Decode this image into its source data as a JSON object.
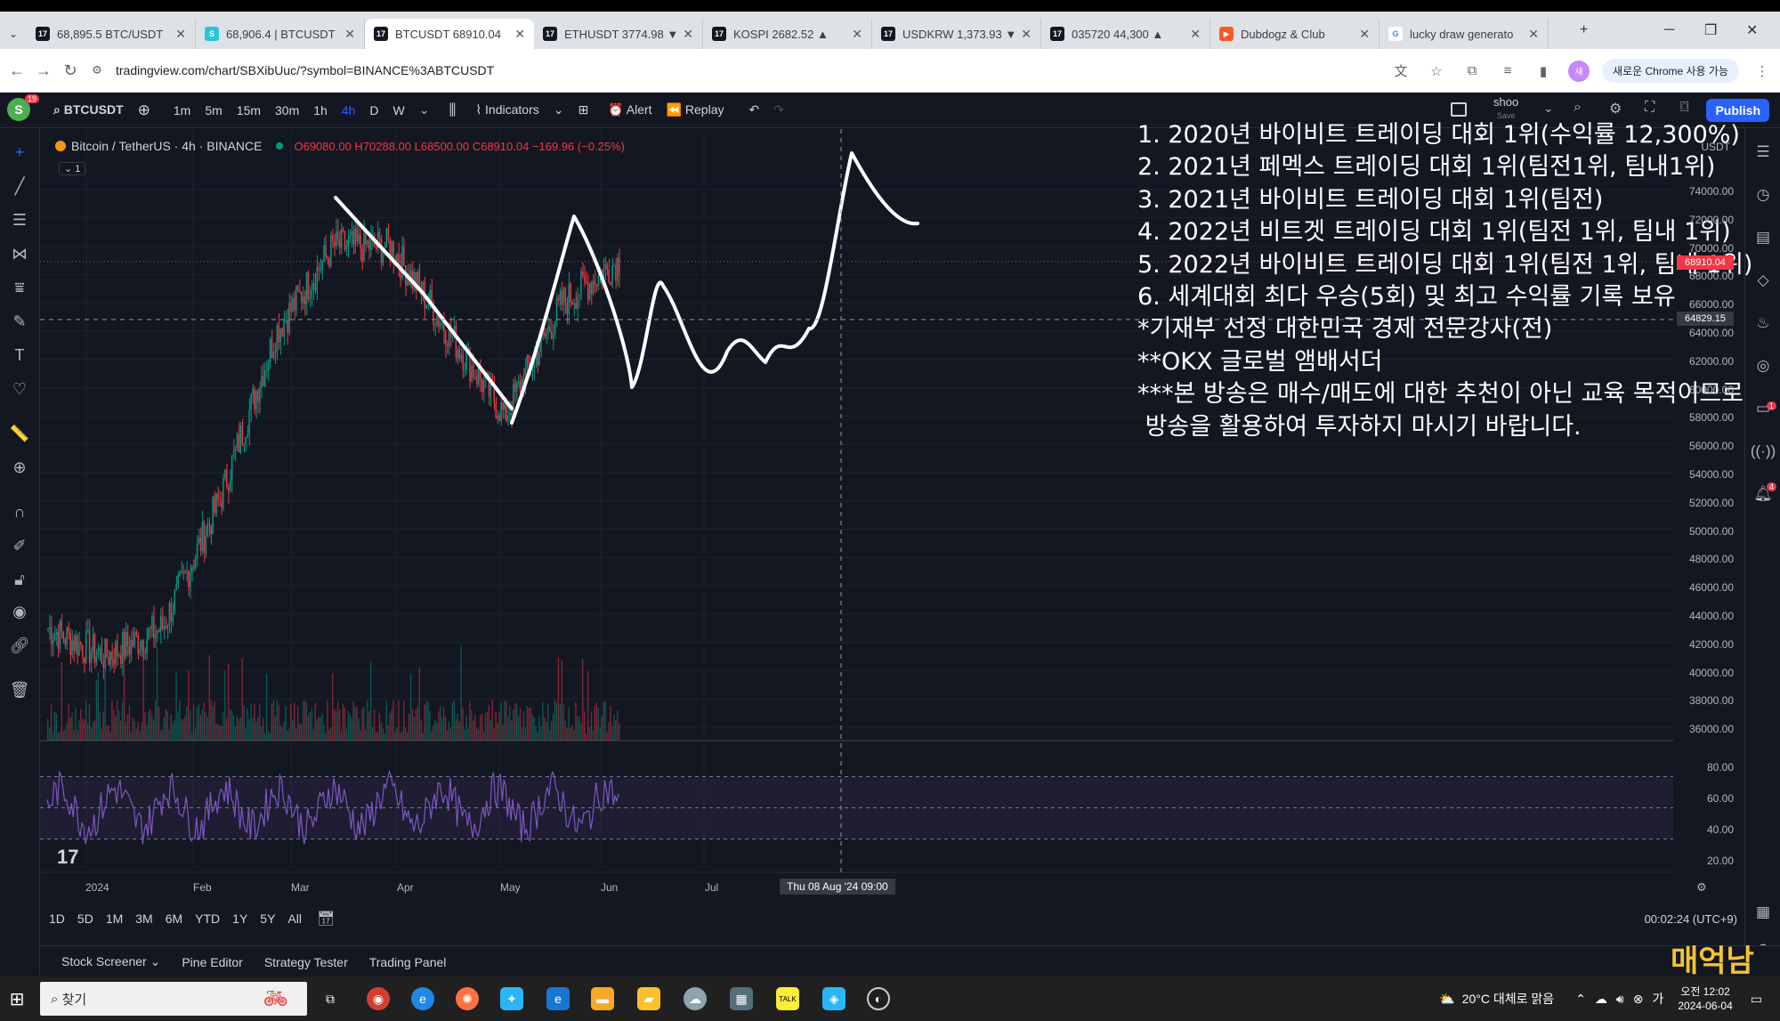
{
  "browser": {
    "tabs": [
      {
        "label": "68,895.5 BTC/USDT",
        "icon": "tradingview"
      },
      {
        "label": "68,906.4 | BTCUSDT",
        "icon": "cyan-s"
      },
      {
        "label": "BTCUSDT 68910.04",
        "icon": "tradingview"
      },
      {
        "label": "ETHUSDT 3774.98 ▼",
        "icon": "tradingview"
      },
      {
        "label": "KOSPI 2682.52 ▲",
        "icon": "tradingview"
      },
      {
        "label": "USDKRW 1,373.93 ▼",
        "icon": "tradingview"
      },
      {
        "label": "035720 44,300 ▲",
        "icon": "tradingview"
      },
      {
        "label": "Dubdogz & Club",
        "icon": "youtube"
      },
      {
        "label": "lucky draw generato",
        "icon": "google"
      }
    ],
    "url": "tradingview.com/chart/SBXibUuc/?symbol=BINANCE%3ABTCUSDT",
    "chrome_button": "새로운 Chrome 사용 가능"
  },
  "toolbar": {
    "avatar": "S",
    "avatar_badge": "19",
    "symbol": "BTCUSDT",
    "intervals": [
      "1m",
      "5m",
      "15m",
      "30m",
      "1h",
      "4h",
      "D",
      "W"
    ],
    "selected_interval": "4h",
    "indicators": "Indicators",
    "alert": "Alert",
    "replay": "Replay",
    "layout_name": "shoo",
    "layout_sub": "Save",
    "publish": "Publish"
  },
  "legend": {
    "symbol": "Bitcoin / TetherUS · 4h · BINANCE",
    "ohlc": "O69080.00 H70288.00 L68500.00 C68910.04 −169.96 (−0.25%)",
    "collapse": "1"
  },
  "overlay": {
    "lines": [
      "1. 2020년 바이비트 트레이딩 대회 1위(수익률 12,300%)",
      "2. 2021년 페멕스 트레이딩 대회 1위(팀전1위, 팀내1위)",
      "3. 2021년 바이비트 트레이딩 대회 1위(팀전)",
      "4. 2022년 비트겟 트레이딩 대회 1위(팀전 1위, 팀내 1위)",
      "5. 2022년 바이비트 트레이딩 대회 1위(팀전 1위, 팀내 1위)",
      "6. 세계대회 최다 우승(5회) 및 최고 수익률 기록 보유",
      "*기재부 선정 대한민국 경제 전문강사(전)",
      "**OKX 글로벌 앰배서더",
      "***본 방송은 매수/매도에 대한 추천이 아닌 교육 목적이므로",
      " 방송을 활용하여 투자하지 마시기 바랍니다."
    ]
  },
  "price_axis": {
    "currency": "USDT",
    "ticks": [
      "74000.00",
      "72000.00",
      "70000.00",
      "68000.00",
      "66000.00",
      "64000.00",
      "62000.00",
      "60000.00",
      "58000.00",
      "56000.00",
      "54000.00",
      "52000.00",
      "50000.00",
      "48000.00",
      "46000.00",
      "44000.00",
      "42000.00",
      "40000.00",
      "38000.00",
      "36000.00"
    ],
    "current_price": "68910.04",
    "crosshair_price": "64829.15",
    "rsi_ticks": [
      "80.00",
      "60.00",
      "40.00",
      "20.00"
    ]
  },
  "time_axis": {
    "labels": [
      "2024",
      "Feb",
      "Mar",
      "Apr",
      "May",
      "Jun",
      "Jul"
    ],
    "crosshair": "Thu 08 Aug '24   09:00"
  },
  "bottom": {
    "ranges": [
      "1D",
      "5D",
      "1M",
      "3M",
      "6M",
      "YTD",
      "1Y",
      "5Y",
      "All"
    ],
    "clock": "00:02:24 (UTC+9)",
    "panel_tabs": [
      "Stock Screener",
      "Pine Editor",
      "Strategy Tester",
      "Trading Panel"
    ]
  },
  "watermark": "매억남",
  "taskbar": {
    "search": "찾기",
    "weather": "20°C 대체로 맑음",
    "time": "오전 12:02",
    "date": "2024-06-04"
  },
  "chart_data": {
    "type": "candlestick",
    "symbol": "BTCUSDT",
    "interval": "4h",
    "exchange": "BINANCE",
    "x": [
      "Jan 2024",
      "mid Jan",
      "Feb",
      "mid Feb",
      "Mar",
      "mid Mar",
      "Apr",
      "mid Apr",
      "May",
      "mid May",
      "Jun"
    ],
    "close_approx": [
      43000,
      41000,
      43000,
      52000,
      64000,
      70000,
      70000,
      64000,
      58000,
      66000,
      69000
    ],
    "ylim": [
      36000,
      75000
    ],
    "current": 68910.04,
    "rsi_range": [
      20,
      80
    ]
  }
}
